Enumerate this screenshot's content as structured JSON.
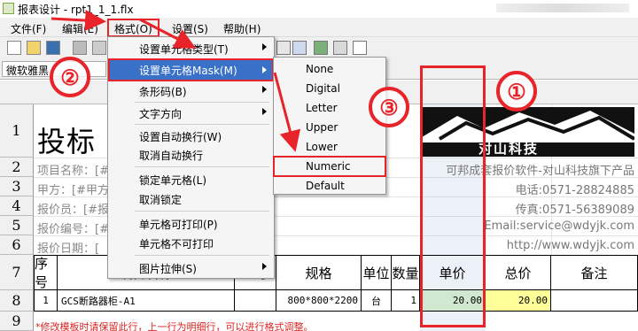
{
  "window": {
    "title": "报表设计 - rpt1_1_1.flx"
  },
  "menubar": [
    {
      "label": "文件(F)"
    },
    {
      "label": "编辑(E)"
    },
    {
      "label": "格式(O)"
    },
    {
      "label": "设置(S)"
    },
    {
      "label": "帮助(H)"
    }
  ],
  "formatbar": {
    "font": "微软雅黑"
  },
  "rows": [
    "1",
    "2",
    "3",
    "4",
    "5",
    "6",
    "7",
    "8",
    "9"
  ],
  "report": {
    "title": "投标",
    "left_info": [
      "项目名称：[#",
      "甲方：[#甲方",
      "报价员：[#报",
      "报价编号：[#",
      "报价日期：["
    ],
    "right_info": [
      "可邦成套报价软件-对山科技旗下产品",
      "电话:0571-28824885",
      "传真:0571-56389089",
      "Email:service@wdyjk.com",
      "http://www.wdyjk.com"
    ],
    "logo_text": "对山科技",
    "headers": [
      "序号",
      "设备名称",
      "型号",
      "规格",
      "单位",
      "数量",
      "单价",
      "总价",
      "备注"
    ],
    "row": [
      "1",
      "GCS断路器柜-A1",
      "",
      "800*800*2200",
      "台",
      "1",
      "20.00",
      "20.00",
      ""
    ],
    "warning": "*修改模板时请保留此行，上一行为明细行，可以进行格式调整。"
  },
  "format_menu": {
    "items": [
      {
        "label": "设置单元格类型(T)",
        "has_sub": true
      },
      {
        "label": "设置单元格Mask(M)",
        "has_sub": true
      },
      {
        "label": "条形码(B)",
        "has_sub": true
      },
      {
        "label": "文字方向",
        "has_sub": true
      },
      {
        "label": "设置自动换行(W)"
      },
      {
        "label": "取消自动换行"
      },
      {
        "label": "锁定单元格(L)"
      },
      {
        "label": "取消锁定"
      },
      {
        "label": "单元格可打印(P)"
      },
      {
        "label": "单元格不可打印"
      },
      {
        "label": "图片拉伸(S)",
        "has_sub": true
      }
    ]
  },
  "mask_submenu": [
    "None",
    "Digital",
    "Letter",
    "Upper",
    "Lower",
    "Numeric",
    "Default"
  ],
  "annotations": {
    "one": "①",
    "two": "②",
    "three": "③",
    "color": "#e8242a"
  },
  "colors": {
    "highlight": "#3a71c8",
    "green_cell": "#cfe8cf",
    "yellow_cell": "#ffff99"
  }
}
